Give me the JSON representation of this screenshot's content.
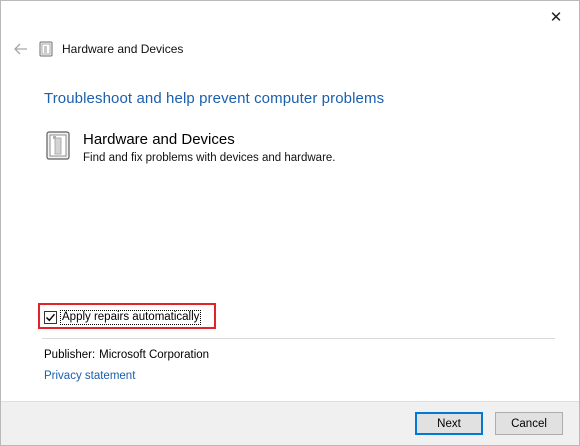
{
  "window": {
    "nav_title": "Hardware and Devices"
  },
  "icons": {
    "close": "close-icon",
    "back": "back-arrow-icon",
    "troubleshooter": "hardware-device-icon"
  },
  "main": {
    "heading": "Troubleshoot and help prevent computer problems",
    "item": {
      "title": "Hardware and Devices",
      "description": "Find and fix problems with devices and hardware."
    },
    "apply_repairs": {
      "label": "Apply repairs automatically",
      "checked": true
    },
    "publisher_label": "Publisher:",
    "publisher_value": "Microsoft Corporation",
    "privacy_link": "Privacy statement"
  },
  "footer": {
    "next_label": "Next",
    "cancel_label": "Cancel"
  },
  "colors": {
    "heading_blue": "#1b5fae",
    "highlight_red": "#e1242a",
    "footer_bg": "#f0f0f0"
  }
}
